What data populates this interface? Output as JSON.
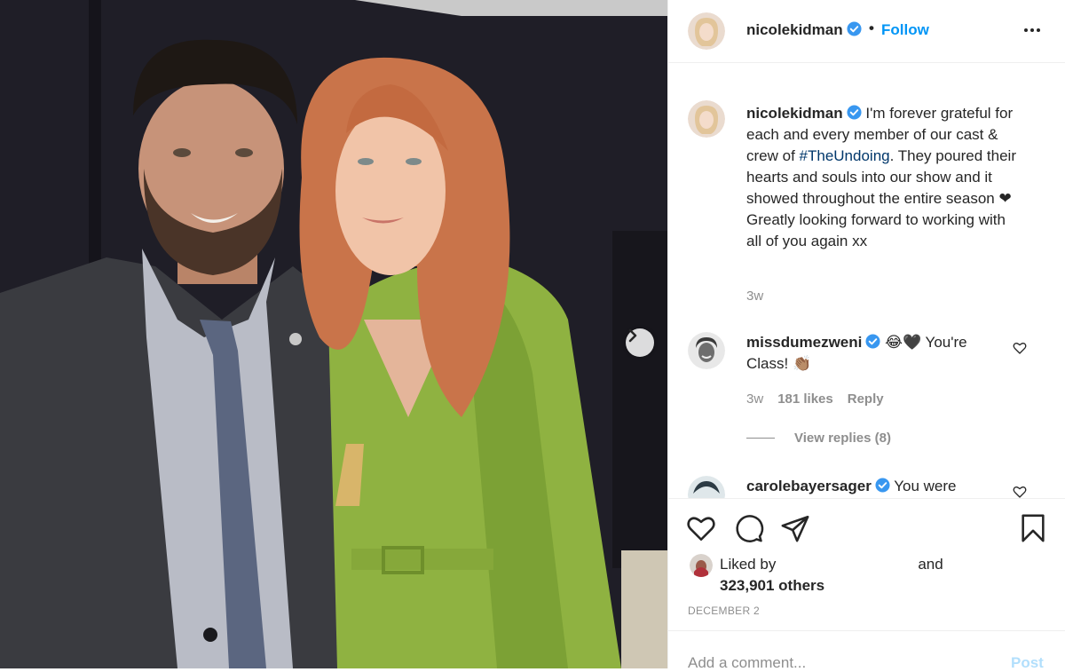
{
  "colors": {
    "accent": "#0095f6",
    "hashtag": "#00376b",
    "muted": "#8e8e8e",
    "text": "#262626"
  },
  "post": {
    "author": "nicolekidman",
    "follow_label": "Follow",
    "dot": "•",
    "more_icon": "more-icon"
  },
  "caption": {
    "author": "nicolekidman",
    "text_before": " I'm forever grateful for each and every member of our cast & crew of ",
    "hashtag": "#TheUndoing",
    "text_after": ". They poured their hearts and souls into our show and it showed throughout the entire season ❤ Greatly looking forward to working with all of you again xx",
    "time": "3w"
  },
  "comments": [
    {
      "author": "missdumezweni",
      "text": " 😂🖤 You're Class! 👏🏽",
      "time": "3w",
      "likes": "181 likes",
      "reply_label": "Reply",
      "view_replies": "View replies (8)"
    },
    {
      "author": "carolebayersager",
      "text": " You were"
    }
  ],
  "engagement": {
    "liked_by_prefix": "Liked by",
    "liked_by_and": "and",
    "others": "323,901 others",
    "date": "DECEMBER 2"
  },
  "add_comment": {
    "placeholder": "Add a comment...",
    "post_label": "Post"
  }
}
